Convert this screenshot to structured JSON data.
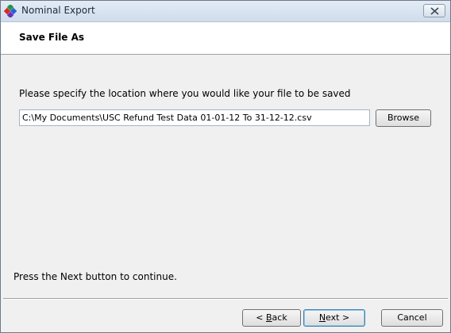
{
  "window": {
    "title": "Nominal Export"
  },
  "header": {
    "title": "Save File As"
  },
  "content": {
    "prompt": "Please specify the location where you would like your file to be saved",
    "file_path": "C:\\My Documents\\USC Refund Test Data 01-01-12 To 31-12-12.csv",
    "browse_label": "Browse",
    "continue_text": "Press the Next button to continue."
  },
  "buttons": {
    "back_prefix": "< ",
    "back_mnemonic": "B",
    "back_rest": "ack",
    "next_mnemonic": "N",
    "next_rest": "ext >",
    "cancel_label": "Cancel"
  },
  "icons": {
    "app": "app-logo-icon",
    "close": "close-icon"
  }
}
